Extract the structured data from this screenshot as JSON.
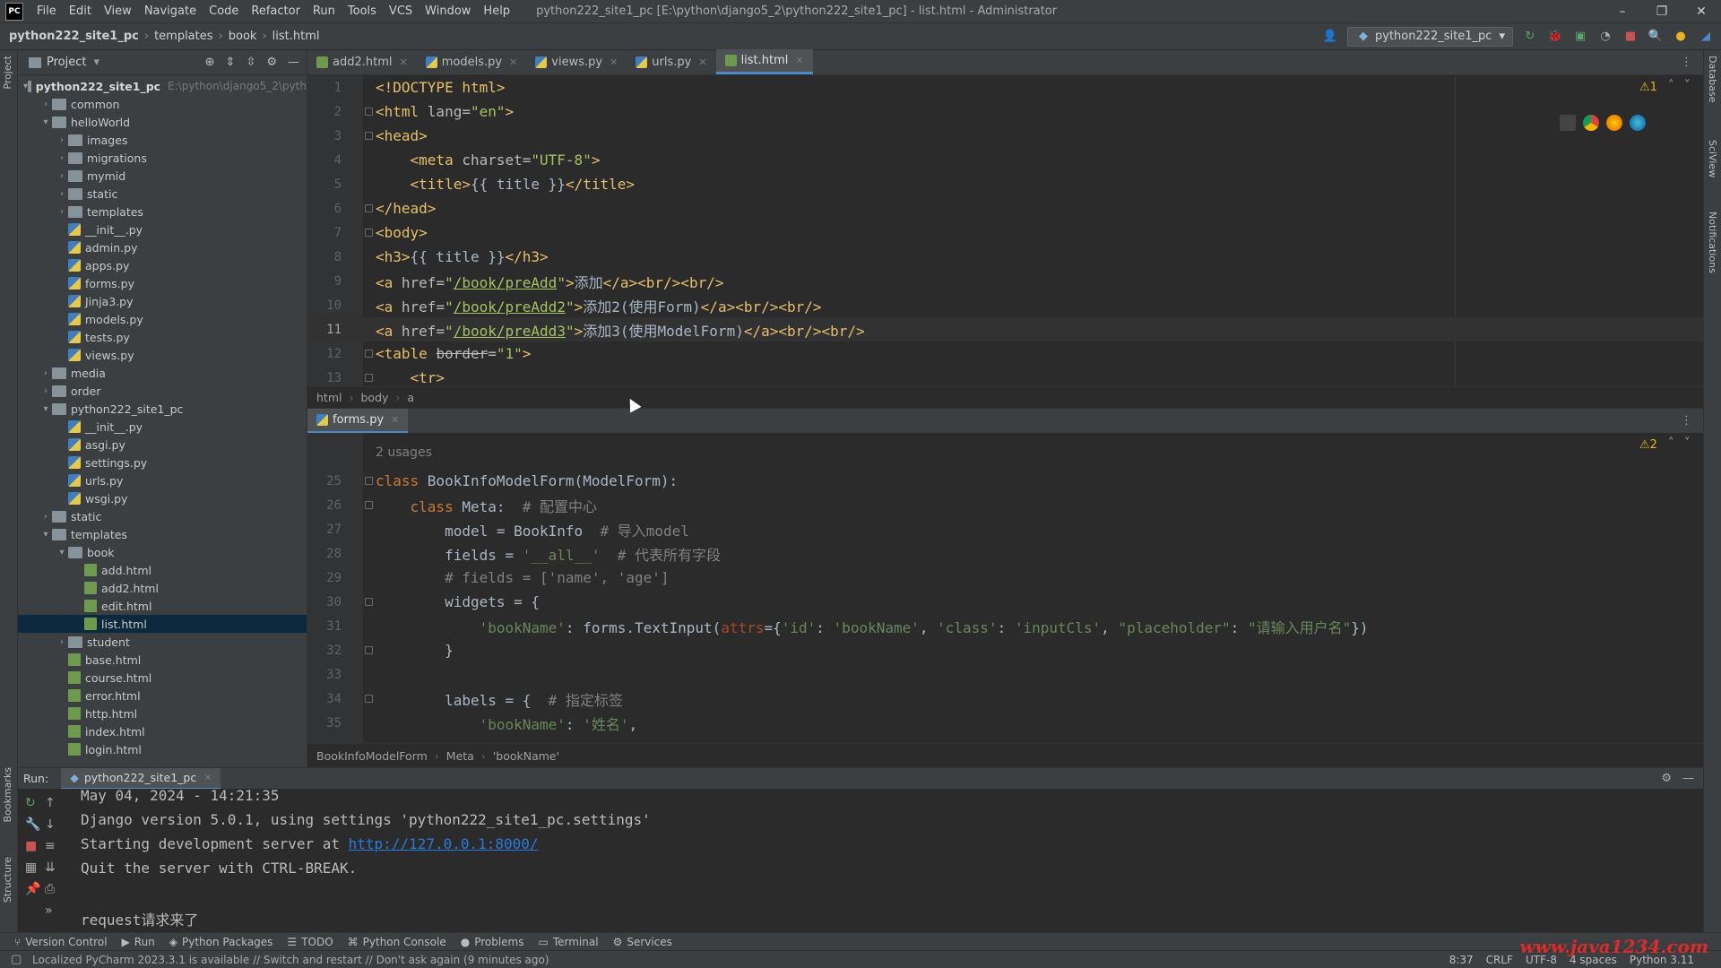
{
  "titlebar": {
    "logo": "PC",
    "menu": [
      "File",
      "Edit",
      "View",
      "Navigate",
      "Code",
      "Refactor",
      "Run",
      "Tools",
      "VCS",
      "Window",
      "Help"
    ],
    "title": "python222_site1_pc [E:\\python\\django5_2\\python222_site1_pc] - list.html - Administrator"
  },
  "navbar": {
    "breadcrumb": [
      "python222_site1_pc",
      "templates",
      "book",
      "list.html"
    ],
    "run_config": "python222_site1_pc"
  },
  "project": {
    "title": "Project",
    "root_hint": "E:\\python\\django5_2\\pyth",
    "tree": [
      {
        "label": "python222_site1_pc",
        "type": "folder",
        "depth": 0,
        "open": true,
        "bold": true
      },
      {
        "label": "common",
        "type": "folder",
        "depth": 1,
        "open": false
      },
      {
        "label": "helloWorld",
        "type": "folder",
        "depth": 1,
        "open": true
      },
      {
        "label": "images",
        "type": "folder",
        "depth": 2,
        "open": false
      },
      {
        "label": "migrations",
        "type": "folder",
        "depth": 2,
        "open": false
      },
      {
        "label": "mymid",
        "type": "folder",
        "depth": 2,
        "open": false
      },
      {
        "label": "static",
        "type": "folder",
        "depth": 2,
        "open": false
      },
      {
        "label": "templates",
        "type": "folder",
        "depth": 2,
        "open": false
      },
      {
        "label": "__init__.py",
        "type": "py",
        "depth": 2
      },
      {
        "label": "admin.py",
        "type": "py",
        "depth": 2
      },
      {
        "label": "apps.py",
        "type": "py",
        "depth": 2
      },
      {
        "label": "forms.py",
        "type": "py",
        "depth": 2
      },
      {
        "label": "Jinja3.py",
        "type": "py",
        "depth": 2
      },
      {
        "label": "models.py",
        "type": "py",
        "depth": 2
      },
      {
        "label": "tests.py",
        "type": "py",
        "depth": 2
      },
      {
        "label": "views.py",
        "type": "py",
        "depth": 2
      },
      {
        "label": "media",
        "type": "folder",
        "depth": 1,
        "open": false
      },
      {
        "label": "order",
        "type": "folder",
        "depth": 1,
        "open": false
      },
      {
        "label": "python222_site1_pc",
        "type": "folder",
        "depth": 1,
        "open": true
      },
      {
        "label": "__init__.py",
        "type": "py",
        "depth": 2
      },
      {
        "label": "asgi.py",
        "type": "py",
        "depth": 2
      },
      {
        "label": "settings.py",
        "type": "py",
        "depth": 2
      },
      {
        "label": "urls.py",
        "type": "py",
        "depth": 2
      },
      {
        "label": "wsgi.py",
        "type": "py",
        "depth": 2
      },
      {
        "label": "static",
        "type": "folder",
        "depth": 1,
        "open": false
      },
      {
        "label": "templates",
        "type": "folder",
        "depth": 1,
        "open": true
      },
      {
        "label": "book",
        "type": "folder",
        "depth": 2,
        "open": true
      },
      {
        "label": "add.html",
        "type": "html",
        "depth": 3
      },
      {
        "label": "add2.html",
        "type": "html",
        "depth": 3
      },
      {
        "label": "edit.html",
        "type": "html",
        "depth": 3
      },
      {
        "label": "list.html",
        "type": "html",
        "depth": 3,
        "selected": true
      },
      {
        "label": "student",
        "type": "folder",
        "depth": 2,
        "open": false
      },
      {
        "label": "base.html",
        "type": "html",
        "depth": 2
      },
      {
        "label": "course.html",
        "type": "html",
        "depth": 2
      },
      {
        "label": "error.html",
        "type": "html",
        "depth": 2
      },
      {
        "label": "http.html",
        "type": "html",
        "depth": 2
      },
      {
        "label": "index.html",
        "type": "html",
        "depth": 2
      },
      {
        "label": "login.html",
        "type": "html",
        "depth": 2
      }
    ]
  },
  "editor_tabs": [
    {
      "label": "add2.html",
      "kind": "html"
    },
    {
      "label": "models.py",
      "kind": "py"
    },
    {
      "label": "views.py",
      "kind": "py"
    },
    {
      "label": "urls.py",
      "kind": "py"
    },
    {
      "label": "list.html",
      "kind": "html",
      "active": true
    }
  ],
  "top_editor": {
    "warning_count": "1",
    "breadcrumb": [
      "html",
      "body",
      "a"
    ],
    "current_line": 11,
    "lines": [
      {
        "n": "1",
        "html": "<span class='tag'>&lt;!DOCTYPE html&gt;</span>"
      },
      {
        "n": "2",
        "html": "<span class='tag'>&lt;html </span><span class='attr'>lang=</span><span class='val'>\"en\"</span><span class='tag'>&gt;</span>"
      },
      {
        "n": "3",
        "html": "<span class='tag'>&lt;head&gt;</span>"
      },
      {
        "n": "4",
        "html": "    <span class='tag'>&lt;meta </span><span class='attr'>charset=</span><span class='val'>\"UTF-8\"</span><span class='tag'>&gt;</span>"
      },
      {
        "n": "5",
        "html": "    <span class='tag'>&lt;title&gt;</span><span class='txt'>{{ title }}</span><span class='tag'>&lt;/title&gt;</span>"
      },
      {
        "n": "6",
        "html": "<span class='tag'>&lt;/head&gt;</span>"
      },
      {
        "n": "7",
        "html": "<span class='tag'>&lt;body&gt;</span>"
      },
      {
        "n": "8",
        "html": "<span class='tag'>&lt;h3&gt;</span><span class='txt'>{{ title }}</span><span class='tag'>&lt;/h3&gt;</span>"
      },
      {
        "n": "9",
        "html": "<span class='tag'>&lt;a </span><span class='attr'>href=</span><span class='val'>\"</span><span class='link'>/book/preAdd</span><span class='val'>\"</span><span class='tag'>&gt;</span><span class='txt'>添加</span><span class='tag'>&lt;/a&gt;&lt;br/&gt;&lt;br/&gt;</span>"
      },
      {
        "n": "10",
        "html": "<span class='tag'>&lt;a </span><span class='attr'>href=</span><span class='val'>\"</span><span class='link'>/book/preAdd2</span><span class='val'>\"</span><span class='tag'>&gt;</span><span class='txt'>添加2(使用Form)</span><span class='tag'>&lt;/a&gt;&lt;br/&gt;&lt;br/&gt;</span>"
      },
      {
        "n": "11",
        "html": "<span class='tag'>&lt;a </span><span class='attr'>href=</span><span class='val'>\"</span><span class='link'>/book/preAdd3</span><span class='val'>\"</span><span class='tag'>&gt;</span><span class='txt'>添加3(使用ModelForm)</span><span class='tag'>&lt;/a&gt;&lt;br/&gt;&lt;br/&gt;</span>"
      },
      {
        "n": "12",
        "html": "<span class='tag'>&lt;table </span><span class='strike'>border</span><span class='attr'>=</span><span class='val'>\"1\"</span><span class='tag'>&gt;</span>"
      },
      {
        "n": "13",
        "html": "    <span class='tag'>&lt;tr&gt;</span>"
      }
    ]
  },
  "bottom_editor": {
    "tab": "forms.py",
    "warning_count": "2",
    "usages": "2 usages",
    "breadcrumb": [
      "BookInfoModelForm",
      "Meta",
      "'bookName'"
    ],
    "lines": [
      {
        "n": "25",
        "html": "<span class='kw'>class </span><span class='txt'>BookInfoModelForm(ModelForm):</span>"
      },
      {
        "n": "26",
        "html": "    <span class='kw'>class </span><span class='txt'>Meta:  </span><span class='cmt'># 配置中心</span>"
      },
      {
        "n": "27",
        "html": "        <span class='txt'>model = BookInfo  </span><span class='cmt'># 导入model</span>"
      },
      {
        "n": "28",
        "html": "        <span class='txt'>fields = </span><span class='str'>'__all__'</span><span class='txt'>  </span><span class='cmt'># 代表所有字段</span>"
      },
      {
        "n": "29",
        "html": "        <span class='cmt'># fields = ['name', 'age']</span>"
      },
      {
        "n": "30",
        "html": "        <span class='txt'>widgets = {</span>"
      },
      {
        "n": "31",
        "html": "            <span class='str'>'bookName'</span><span class='txt'>: forms.TextInput(</span><span class='param'>attrs</span><span class='txt'>={</span><span class='str'>'id'</span><span class='txt'>: </span><span class='str'>'bookName'</span><span class='txt'>, </span><span class='str'>'class'</span><span class='txt'>: </span><span class='str'>'inputCls'</span><span class='txt'>, </span><span class='str'>\"placeholder\"</span><span class='txt'>: </span><span class='str'>\"请输入用户名\"</span><span class='txt'>})</span>"
      },
      {
        "n": "32",
        "html": "        <span class='txt'>}</span>"
      },
      {
        "n": "33",
        "html": ""
      },
      {
        "n": "34",
        "html": "        <span class='txt'>labels = {  </span><span class='cmt'># 指定标签</span>"
      },
      {
        "n": "35",
        "html": "            <span class='str'>'bookName'</span><span class='txt'>: </span><span class='str'>'姓名'</span><span class='txt'>,</span>"
      }
    ]
  },
  "run": {
    "label": "Run:",
    "tab": "python222_site1_pc",
    "console": [
      "May 04, 2024 - 14:21:35",
      "Django version 5.0.1, using settings 'python222_site1_pc.settings'",
      "Starting development server at ",
      "Quit the server with CTRL-BREAK.",
      "",
      "request请求来了"
    ],
    "server_url": "http://127.0.0.1:8000/"
  },
  "bottom_tools": [
    "Version Control",
    "Run",
    "Python Packages",
    "TODO",
    "Python Console",
    "Problems",
    "Terminal",
    "Services"
  ],
  "status": {
    "message": "Localized PyCharm 2023.3.1 is available // Switch and restart // Don't ask again (9 minutes ago)",
    "position": "8:37",
    "line_sep": "CRLF",
    "encoding": "UTF-8",
    "indent": "4 spaces",
    "interpreter": "Python 3.11"
  },
  "side_labels": {
    "left_top": "Project",
    "left_bookmarks": "Bookmarks",
    "left_structure": "Structure",
    "right_db": "Database",
    "right_sciview": "SciView",
    "right_notifications": "Notifications"
  },
  "watermark": "www.java1234.com",
  "colors": {
    "accent": "#4a88c7",
    "selection": "#0d293e",
    "background": "#2b2b2b",
    "panel": "#3c3f41"
  }
}
